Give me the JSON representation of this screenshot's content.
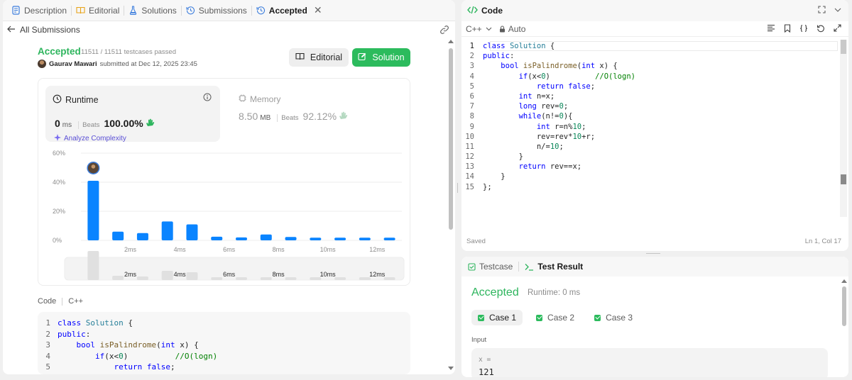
{
  "left_tabs": [
    {
      "label": "Description",
      "icon": "description-icon"
    },
    {
      "label": "Editorial",
      "icon": "book-icon"
    },
    {
      "label": "Solutions",
      "icon": "flask-icon"
    },
    {
      "label": "Submissions",
      "icon": "history-icon"
    },
    {
      "label": "Accepted",
      "icon": "history-icon",
      "active": true
    }
  ],
  "back_label": "All Submissions",
  "submission": {
    "status": "Accepted",
    "testcases": "11511 / 11511 testcases passed",
    "author": "Gaurav Mawari",
    "submitted_at": "submitted at Dec 12, 2025 23:45",
    "editorial_label": "Editorial",
    "solution_label": "Solution"
  },
  "runtime": {
    "title": "Runtime",
    "value": "0",
    "unit": "ms",
    "beats_label": "Beats",
    "beats": "100.00%",
    "analyze": "Analyze Complexity"
  },
  "memory": {
    "title": "Memory",
    "value": "8.50",
    "unit": "MB",
    "beats_label": "Beats",
    "beats": "92.12%"
  },
  "chart_data": {
    "type": "bar",
    "y_ticks": [
      "60%",
      "40%",
      "20%",
      "0%"
    ],
    "ylim": [
      0,
      60
    ],
    "x_tick_labels": [
      "2ms",
      "4ms",
      "6ms",
      "8ms",
      "10ms",
      "12ms"
    ],
    "values": [
      41,
      6,
      5,
      13,
      11,
      2.5,
      2,
      4,
      2.3,
      1.8,
      1.8,
      1.8,
      1.8
    ],
    "highlight_index": 0,
    "bar_color": "#0a84ff",
    "grid": true
  },
  "code_label": "Code",
  "code_lang": "C++",
  "code_lines": [
    [
      [
        "kw",
        "class"
      ],
      [
        "",
        ""
      ],
      [
        "",
        " "
      ],
      [
        "ty",
        "Solution"
      ],
      [
        "",
        " {"
      ]
    ],
    [
      [
        "kw",
        "public"
      ],
      [
        "",
        ":"
      ]
    ],
    [
      [
        "",
        "    "
      ],
      [
        "kw",
        "bool"
      ],
      [
        "",
        " "
      ],
      [
        "fn",
        "isPalindrome"
      ],
      [
        "",
        "("
      ],
      [
        "kw",
        "int"
      ],
      [
        "",
        " x) {"
      ]
    ],
    [
      [
        "",
        "        "
      ],
      [
        "kw",
        "if"
      ],
      [
        "",
        "(x<"
      ],
      [
        "num",
        "0"
      ],
      [
        "",
        ")          "
      ],
      [
        "cm",
        "//O(logn)"
      ]
    ],
    [
      [
        "",
        "            "
      ],
      [
        "kw",
        "return"
      ],
      [
        "",
        " "
      ],
      [
        "kw",
        "false"
      ],
      [
        "",
        ";"
      ]
    ],
    [
      [
        "",
        "        "
      ],
      [
        "kw",
        "int"
      ],
      [
        "",
        " n=x;"
      ]
    ],
    [
      [
        "",
        "        "
      ],
      [
        "kw",
        "long"
      ],
      [
        "",
        " rev="
      ],
      [
        "num",
        "0"
      ],
      [
        "",
        ";"
      ]
    ],
    [
      [
        "",
        "        "
      ],
      [
        "kw",
        "while"
      ],
      [
        "",
        "(n!="
      ],
      [
        "num",
        "0"
      ],
      [
        "",
        "){"
      ]
    ],
    [
      [
        "",
        "            "
      ],
      [
        "kw",
        "int"
      ],
      [
        "",
        " r=n%"
      ],
      [
        "num",
        "10"
      ],
      [
        "",
        ";"
      ]
    ],
    [
      [
        "",
        "            rev=rev*"
      ],
      [
        "num",
        "10"
      ],
      [
        "",
        "+r;"
      ]
    ],
    [
      [
        "",
        "            n/="
      ],
      [
        "num",
        "10"
      ],
      [
        "",
        ";"
      ]
    ],
    [
      [
        "",
        "        }"
      ]
    ],
    [
      [
        "",
        "        "
      ],
      [
        "kw",
        "return"
      ],
      [
        "",
        " rev==x;"
      ]
    ],
    [
      [
        "",
        "    }"
      ]
    ],
    [
      [
        "",
        "};"
      ]
    ]
  ],
  "code_panel": {
    "title": "Code",
    "lang": "C++",
    "mode": "Auto",
    "saved": "Saved",
    "cursor": "Ln 1, Col 17"
  },
  "result_panel": {
    "tab_testcase": "Testcase",
    "tab_result": "Test Result",
    "status": "Accepted",
    "runtime": "Runtime: 0 ms",
    "cases": [
      "Case 1",
      "Case 2",
      "Case 3"
    ],
    "input_label": "Input",
    "input_var": "x =",
    "input_value": "121"
  }
}
